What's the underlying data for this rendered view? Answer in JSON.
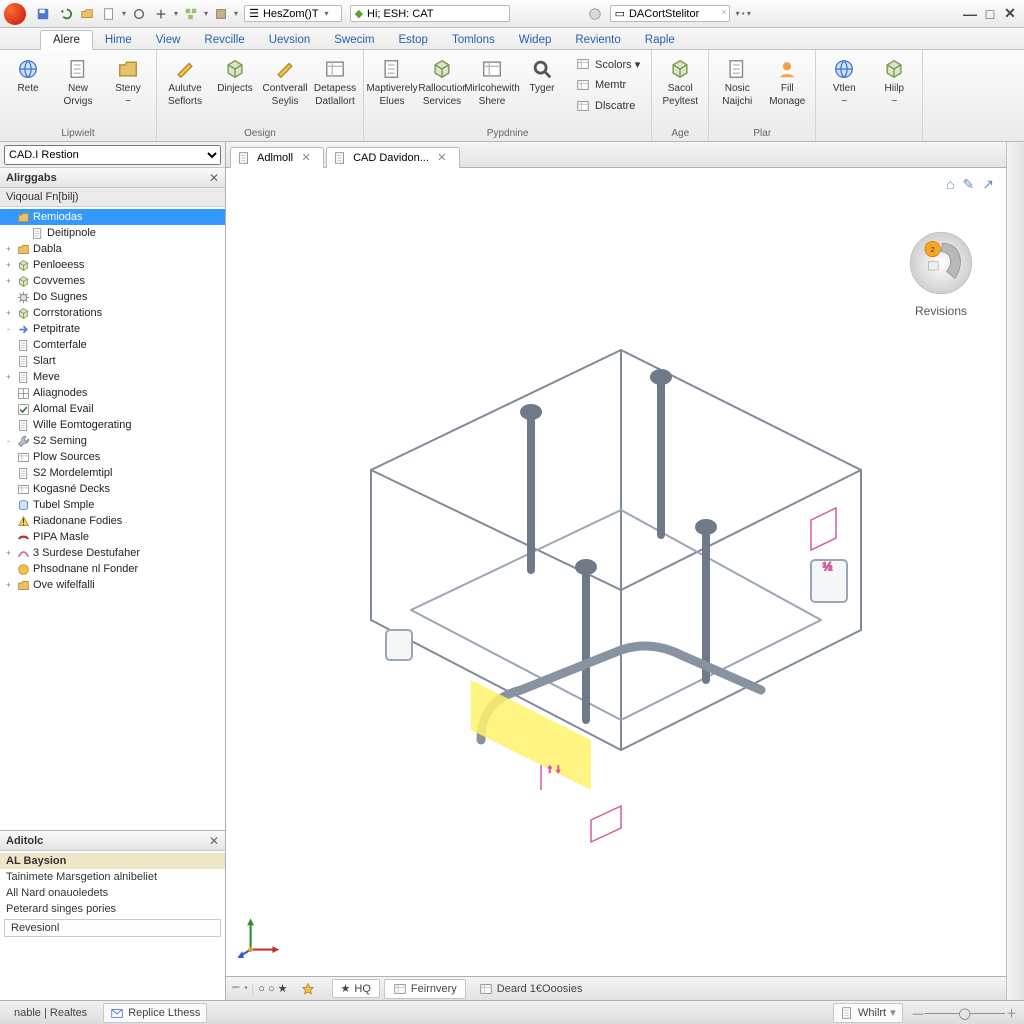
{
  "titlebar": {
    "doc1_label": "HesZom()T",
    "doc2_label": "Hi; ESH: CAT",
    "doc3_label": "DACortStelitor"
  },
  "ribbon_tabs": [
    "Alere",
    "Hime",
    "View",
    "Revcille",
    "Uevsion",
    "Swecim",
    "Estop",
    "Tomlons",
    "Widep",
    "Reviento",
    "Raple"
  ],
  "ribbon_active_index": 0,
  "ribbon": {
    "groups": [
      {
        "label": "Lipwielt",
        "items": [
          {
            "l1": "Rete",
            "l2": ""
          },
          {
            "l1": "New",
            "l2": "Orvigs"
          },
          {
            "l1": "Steny",
            "l2": "~"
          }
        ]
      },
      {
        "label": "Oesign",
        "items": [
          {
            "l1": "Aulutve",
            "l2": "Seflorts"
          },
          {
            "l1": "Dinjects",
            "l2": ""
          },
          {
            "l1": "Contverall",
            "l2": "Seylis"
          },
          {
            "l1": "Detapess",
            "l2": "Datlallort"
          }
        ]
      },
      {
        "label": "Pypdnine",
        "items": [
          {
            "l1": "Maptiverely",
            "l2": "Elues"
          },
          {
            "l1": "Rallocutior",
            "l2": "Services"
          },
          {
            "l1": "Mirlcohewith",
            "l2": "Shere"
          },
          {
            "l1": "Tyger",
            "l2": ""
          }
        ],
        "stack": [
          {
            "label": "Scolors",
            "caret": true
          },
          {
            "label": "Memtr"
          },
          {
            "label": "Dlscatre"
          }
        ]
      },
      {
        "label": "Age",
        "items": [
          {
            "l1": "Sacol",
            "l2": "Peyltest"
          }
        ]
      },
      {
        "label": "Plar",
        "items": [
          {
            "l1": "Nosic",
            "l2": "Naijchi"
          },
          {
            "l1": "Fill",
            "l2": "Monage"
          }
        ]
      },
      {
        "label": "",
        "items": [
          {
            "l1": "Vtlen",
            "l2": "~"
          },
          {
            "l1": "Hiilp",
            "l2": "~"
          }
        ]
      }
    ]
  },
  "left": {
    "dropdown": "CAD.I Restion",
    "panel1": {
      "title": "Alirggabs",
      "filter": "Viqoual Fn[bilj)"
    },
    "tree": [
      {
        "label": "Remiodas",
        "sel": true,
        "indent": 0,
        "exp": "-",
        "icon": "folder"
      },
      {
        "label": "Deitipnole",
        "indent": 1,
        "icon": "doc"
      },
      {
        "label": "Dabla",
        "indent": 0,
        "exp": "+",
        "icon": "folder"
      },
      {
        "label": "Penloeess",
        "indent": 0,
        "exp": "+",
        "icon": "cube"
      },
      {
        "label": "Covvemes",
        "indent": 0,
        "exp": "+",
        "icon": "cube"
      },
      {
        "label": "Do Sugnes",
        "indent": 0,
        "exp": "",
        "icon": "gear"
      },
      {
        "label": "Corrstorations",
        "indent": 0,
        "exp": "+",
        "icon": "cube"
      },
      {
        "label": "Petpitrate",
        "indent": 0,
        "exp": "-",
        "icon": "arrow"
      },
      {
        "label": "Comterfale",
        "indent": 0,
        "exp": "",
        "icon": "doc"
      },
      {
        "label": "Slart",
        "indent": 0,
        "exp": "",
        "icon": "doc"
      },
      {
        "label": "Meve",
        "indent": 0,
        "exp": "+",
        "icon": "doc"
      },
      {
        "label": "Aliagnodes",
        "indent": 0,
        "exp": "",
        "icon": "grid"
      },
      {
        "label": "Alomal Evail",
        "indent": 0,
        "exp": "",
        "icon": "check"
      },
      {
        "label": "Wille Eomtogerating",
        "indent": 0,
        "exp": "",
        "icon": "doc"
      },
      {
        "label": "S2 Seming",
        "indent": 0,
        "exp": "-",
        "icon": "tool"
      },
      {
        "label": "Plow Sources",
        "indent": 0,
        "exp": "",
        "icon": "sheet"
      },
      {
        "label": "S2 Mordelemtipl",
        "indent": 0,
        "exp": "",
        "icon": "doc"
      },
      {
        "label": "Kogasné Decks",
        "indent": 0,
        "exp": "",
        "icon": "sheet"
      },
      {
        "label": "Tubel Smple",
        "indent": 0,
        "exp": "",
        "icon": "tube"
      },
      {
        "label": "Riadonane Fodies",
        "indent": 0,
        "exp": "",
        "icon": "warn"
      },
      {
        "label": "PIPA Masle",
        "indent": 0,
        "exp": "",
        "icon": "pipe"
      },
      {
        "label": "3 Surdese Destufaher",
        "indent": 0,
        "exp": "+",
        "icon": "surf"
      },
      {
        "label": "Phsodnane nl Fonder",
        "indent": 0,
        "exp": "",
        "icon": "badge"
      },
      {
        "label": "Ove wifelfalli",
        "indent": 0,
        "exp": "+",
        "icon": "folder"
      }
    ],
    "panel2": {
      "title": "Aditolc",
      "items": [
        {
          "label": "AL Baysion",
          "cat": true
        },
        {
          "label": "Tainimete Marsgetion alnibeliet"
        },
        {
          "label": "All Nard onauoledets"
        },
        {
          "label": "Peterard singes pories"
        },
        {
          "label": "Revesionl",
          "box": true
        }
      ]
    }
  },
  "doc_tabs": [
    {
      "label": "Adlmoll",
      "close": true
    },
    {
      "label": "CAD Davidon...",
      "close": true
    }
  ],
  "viewcube": {
    "label": "Revisions",
    "badge": "2"
  },
  "bottom_tabs": {
    "items": [
      {
        "label": "",
        "icon": "star",
        "plain": true
      },
      {
        "label": "HQ",
        "icon": "",
        "plain": false,
        "star": true
      },
      {
        "label": "Feirnvery",
        "icon": "sheet"
      },
      {
        "label": "Deard 1€Ooosies",
        "icon": "sheet",
        "plain": true
      }
    ]
  },
  "statusbar": {
    "left": [
      {
        "label": "nable | Realtes",
        "plain": true
      },
      {
        "label": "Replice Lthess",
        "icon": "mail"
      }
    ],
    "right": [
      {
        "label": "Whilrt",
        "icon": "doc"
      }
    ]
  }
}
